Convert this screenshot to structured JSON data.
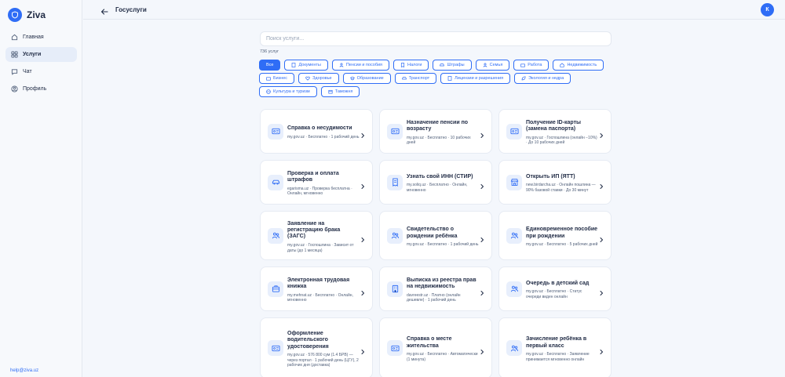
{
  "brand": {
    "name": "Ziva"
  },
  "nav": [
    {
      "label": "Главная",
      "icon": "home-icon",
      "active": false
    },
    {
      "label": "Услуги",
      "icon": "services-icon",
      "active": true
    },
    {
      "label": "Чат",
      "icon": "chat-icon",
      "active": false
    },
    {
      "label": "Профиль",
      "icon": "profile-icon",
      "active": false
    }
  ],
  "help_email": "help@ziva.uz",
  "header": {
    "title": "Госуслуги",
    "avatar_initial": "К"
  },
  "search": {
    "placeholder": "Поиск услуги...",
    "value": ""
  },
  "count_label": "736 услуг",
  "categories": [
    {
      "label": "Все",
      "active": true
    },
    {
      "label": "Документы",
      "active": false
    },
    {
      "label": "Пенсии и пособия",
      "active": false
    },
    {
      "label": "Налоги",
      "active": false
    },
    {
      "label": "Штрафы",
      "active": false
    },
    {
      "label": "Семья",
      "active": false
    },
    {
      "label": "Работа",
      "active": false
    },
    {
      "label": "Недвижимость",
      "active": false
    },
    {
      "label": "Бизнес",
      "active": false
    },
    {
      "label": "Здоровье",
      "active": false
    },
    {
      "label": "Образование",
      "active": false
    },
    {
      "label": "Транспорт",
      "active": false
    },
    {
      "label": "Лицензии и разрешения",
      "active": false
    },
    {
      "label": "Экология и недра",
      "active": false
    },
    {
      "label": "Культура и туризм",
      "active": false
    },
    {
      "label": "Таможня",
      "active": false
    }
  ],
  "services": [
    {
      "title": "Справка о несудимости",
      "meta": "my.gov.uz · Бесплатно · 1 рабочий день",
      "icon": "id-card-icon"
    },
    {
      "title": "Назначение пенсии по возрасту",
      "meta": "my.gov.uz · Бесплатно · 10 рабочих дней",
      "icon": "id-card-icon"
    },
    {
      "title": "Получение ID-карты (замена паспорта)",
      "meta": "my.gov.uz · Госпошлина (онлайн −10%) · До 10 рабочих дней",
      "icon": "id-card-icon"
    },
    {
      "title": "Проверка и оплата штрафов",
      "meta": "egarisma.uz · Проверка бесплатна · Онлайн, мгновенно",
      "icon": "car-icon"
    },
    {
      "title": "Узнать свой ИНН (СТИР)",
      "meta": "my.soliq.uz · Бесплатно · Онлайн, мгновенно",
      "icon": "receipt-icon"
    },
    {
      "title": "Открыть ИП (ЯТТ)",
      "meta": "new.birdarcha.uz · Онлайн пошлина — 90% базовой ставки · До 30 минут",
      "icon": "store-icon"
    },
    {
      "title": "Заявление на регистрацию брака (ЗАГС)",
      "meta": "my.gov.uz · Госпошлина · Зависит от даты (до 1 месяца)",
      "icon": "people-icon"
    },
    {
      "title": "Свидетельство о рождении ребёнка",
      "meta": "my.gov.uz · Бесплатно · 1 рабочий день",
      "icon": "people-icon"
    },
    {
      "title": "Единовременное пособие при рождении",
      "meta": "my.gov.uz · Бесплатно · 5 рабочих дней",
      "icon": "people-icon"
    },
    {
      "title": "Электронная трудовая книжка",
      "meta": "my.mehnat.uz · Бесплатно · Онлайн, мгновенно",
      "icon": "briefcase-icon"
    },
    {
      "title": "Выписка из реестра прав на недвижимость",
      "meta": "davreestr.uz · Платно (онлайн дешевле) · 1 рабочий день",
      "icon": "building-icon"
    },
    {
      "title": "Очередь в детский сад",
      "meta": "my.gov.uz · Бесплатно · Статус очереди виден онлайн",
      "icon": "people-icon"
    },
    {
      "title": "Оформление водительского удостоверения",
      "meta": "my.gov.uz · 576 800 сум (1.4 БРВ) — через портал · 1 рабочий день (ЦГУ), 2 рабочих дня (доставка)",
      "icon": "id-card-icon"
    },
    {
      "title": "Справка о месте жительства",
      "meta": "my.gov.uz · Бесплатно · Автоматически (1 минута)",
      "icon": "id-card-icon"
    },
    {
      "title": "Зачисление ребёнка в первый класс",
      "meta": "my.gov.uz · Бесплатно · Заявление принимается мгновенно онлайн",
      "icon": "people-icon"
    }
  ]
}
